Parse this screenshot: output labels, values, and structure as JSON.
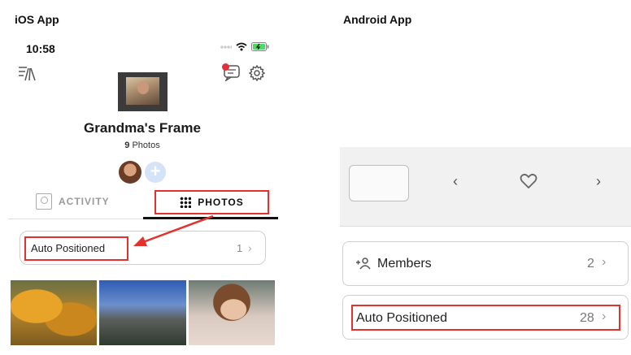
{
  "ios": {
    "heading": "iOS App",
    "time": "10:58",
    "frame_title": "Grandma's Frame",
    "photo_count": "9",
    "photo_count_label": "Photos",
    "tabs": {
      "activity": "ACTIVITY",
      "photos": "PHOTOS"
    },
    "auto_positioned": {
      "label": "Auto Positioned",
      "count": "1"
    }
  },
  "android": {
    "heading": "Android App",
    "members": {
      "label": "Members",
      "count": "2"
    },
    "auto_positioned": {
      "label": "Auto Positioned",
      "count": "28"
    }
  },
  "colors": {
    "highlight": "#e3312d",
    "notification": "#e0303a"
  }
}
